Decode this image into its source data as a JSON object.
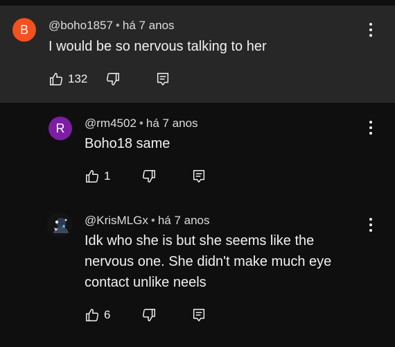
{
  "comments": [
    {
      "avatar_letter": "B",
      "avatar_color": "#f4511e",
      "author": "@boho1857",
      "time": "há 7 anos",
      "text": "I would be so nervous talking to her",
      "likes": "132"
    },
    {
      "avatar_letter": "R",
      "avatar_color": "#7b1fa2",
      "author": "@rm4502",
      "time": "há 7 anos",
      "text": "Boho18 same",
      "likes": "1"
    },
    {
      "avatar_letter": "",
      "avatar_color": "#1a1a1a",
      "author": "@KrisMLGx",
      "time": "há 7 anos",
      "text_lines": [
        "Idk who she is but she seems like the",
        "nervous one. She didn't make much eye",
        "contact unlike neels"
      ],
      "likes": "6"
    }
  ],
  "separator": "•",
  "colors": {
    "highlight_bg": "#272727",
    "page_bg": "#0f0f0f"
  }
}
